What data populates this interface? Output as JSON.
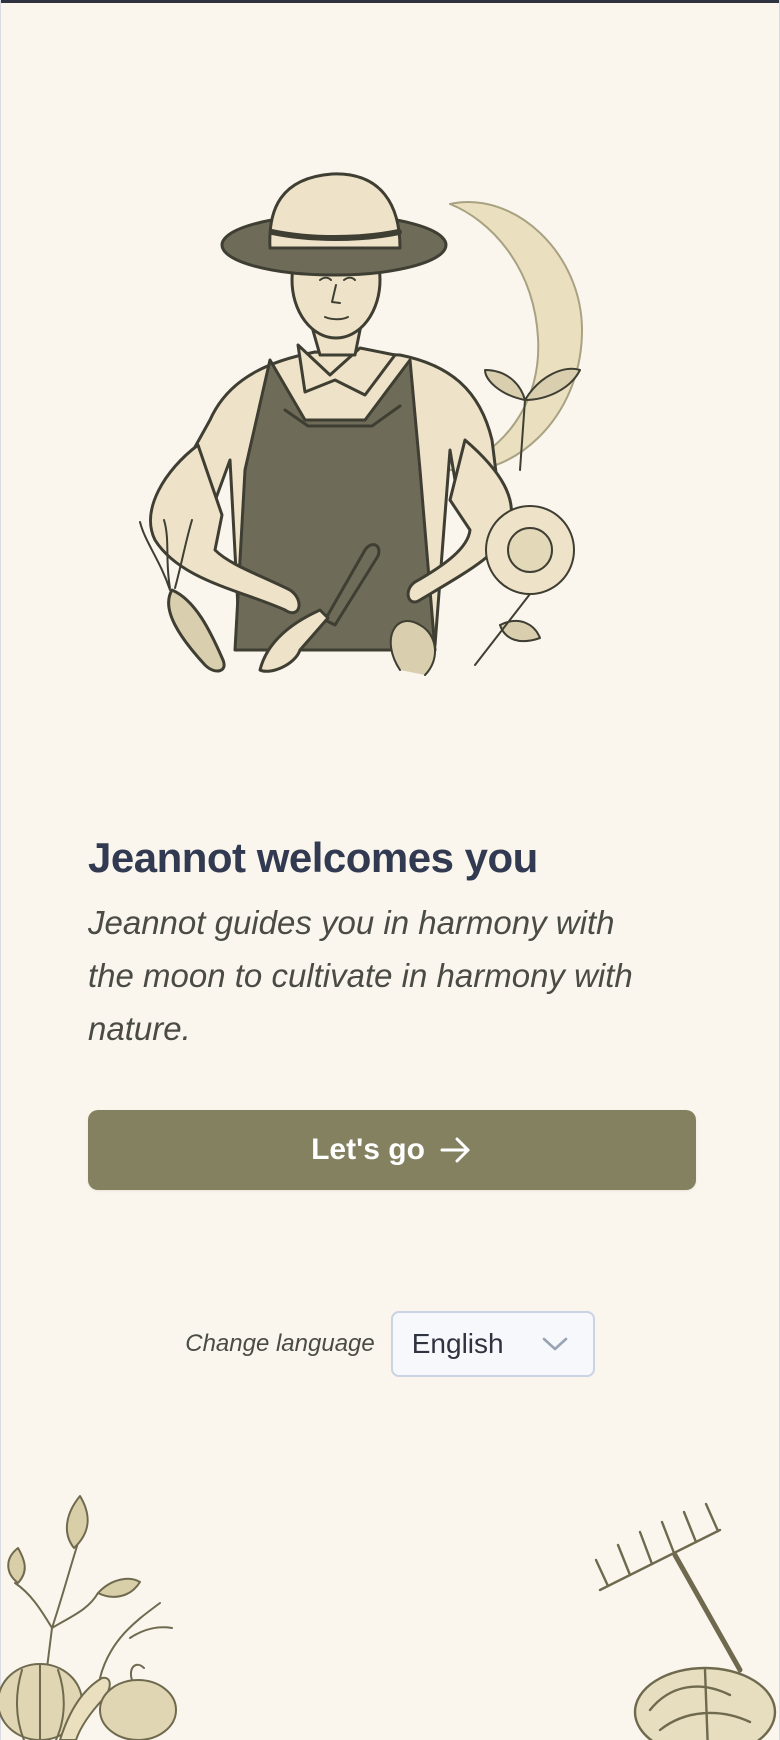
{
  "welcome": {
    "title": "Jeannot welcomes you",
    "subtitle": "Jeannot guides you in harmony with the moon to cultivate in harmony with nature.",
    "cta_label": "Let's go",
    "cta_icon": "arrow-right-icon"
  },
  "language": {
    "label": "Change language",
    "selected": "English",
    "icon": "chevron-down-icon"
  },
  "illustrations": {
    "hero": "gardener-with-moon-illustration",
    "bottom_left": "vegetables-illustration",
    "bottom_right": "rake-and-cabbage-illustration"
  },
  "colors": {
    "background": "#faf6ee",
    "title": "#323a52",
    "button": "#848160",
    "button_text": "#ffffff",
    "select_border": "#c9d3e3"
  }
}
